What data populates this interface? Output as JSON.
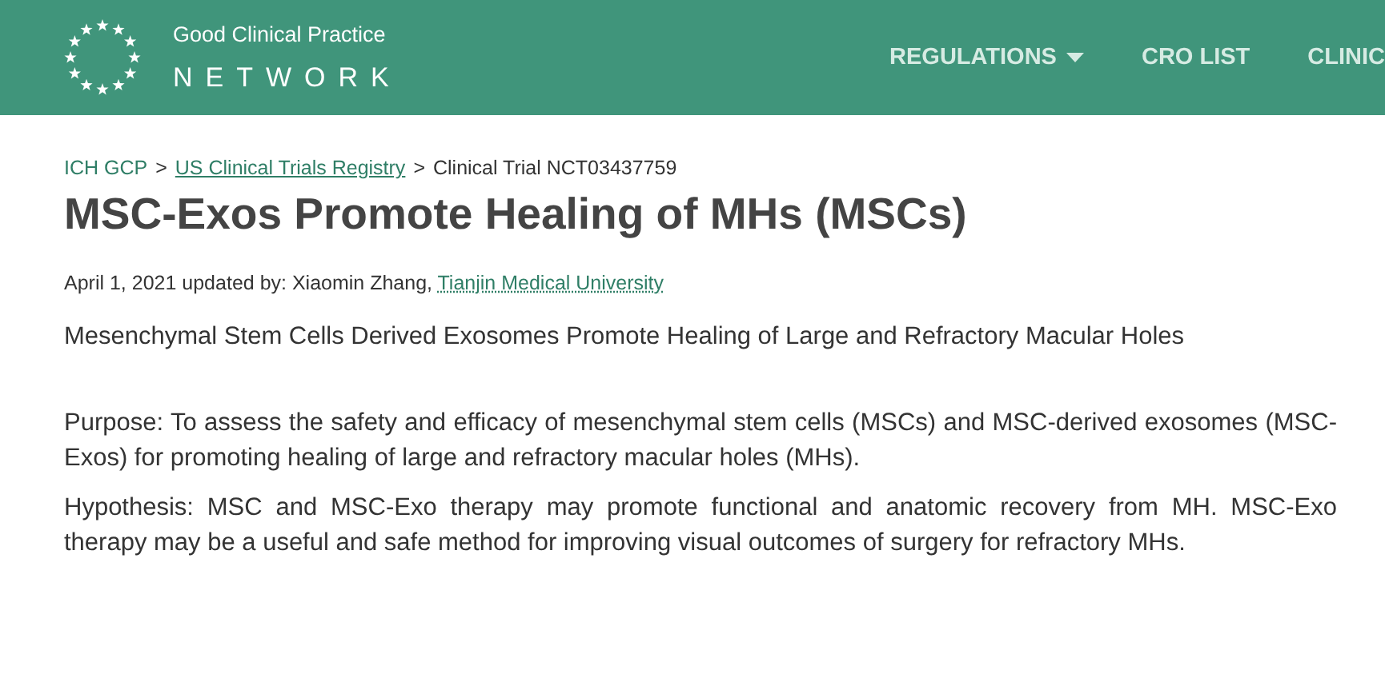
{
  "header": {
    "logo": {
      "line_1": "Good Clinical Practice",
      "line_2": "NETWORK"
    },
    "nav": [
      {
        "label": "REGULATIONS",
        "dropdown": true
      },
      {
        "label": "CRO LIST",
        "dropdown": false
      },
      {
        "label": "CLINIC",
        "dropdown": false
      }
    ]
  },
  "breadcrumb": {
    "separator": ">",
    "items": [
      {
        "label": "ICH GCP",
        "kind": "link"
      },
      {
        "label": "US Clinical Trials Registry",
        "kind": "underlined-link"
      },
      {
        "label": "Clinical Trial NCT03437759",
        "kind": "current"
      }
    ]
  },
  "title": "MSC-Exos Promote Healing of MHs (MSCs)",
  "meta": {
    "text": "April 1, 2021 updated by: Xiaomin Zhang,",
    "link": "Tianjin Medical University"
  },
  "official_title": "Mesenchymal Stem Cells Derived Exosomes Promote Healing of Large and Refractory Macular Holes",
  "paragraphs": [
    "Purpose: To assess the safety and efficacy of mesenchymal stem cells (MSCs) and MSC-derived exosomes (MSC-Exos) for promoting healing of large and refractory macular holes (MHs).",
    "Hypothesis: MSC and MSC-Exo therapy may promote functional and anatomic recovery from MH. MSC-Exo therapy may be a useful and safe method for improving visual outcomes of surgery for refractory MHs."
  ]
}
